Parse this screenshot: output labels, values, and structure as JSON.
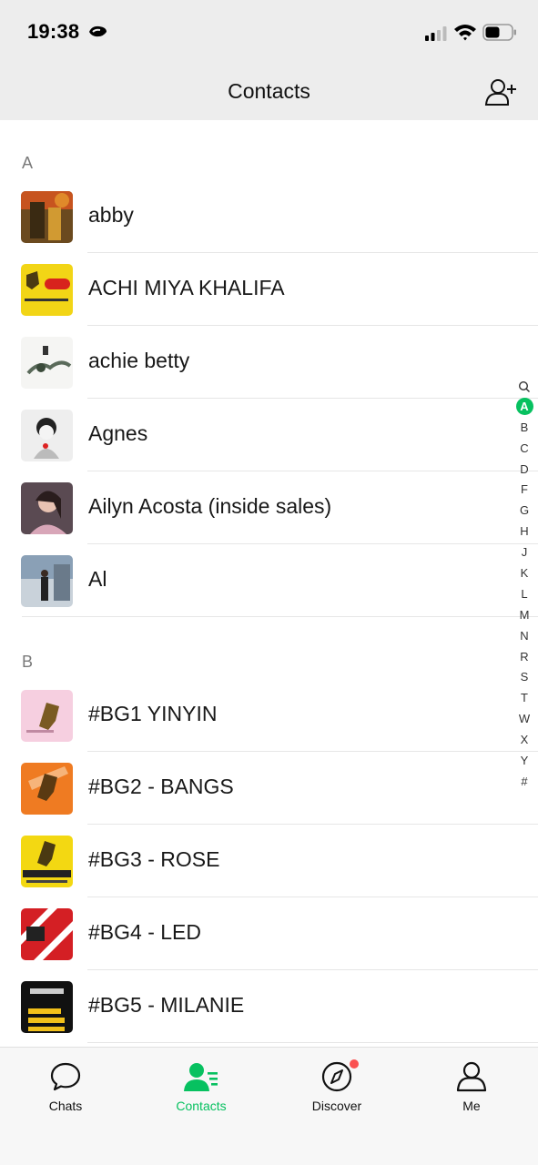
{
  "status_bar": {
    "time": "19:38"
  },
  "header": {
    "title": "Contacts"
  },
  "sections": [
    {
      "letter": "A",
      "contacts": [
        {
          "name": "abby"
        },
        {
          "name": "ACHI MIYA KHALIFA"
        },
        {
          "name": "achie betty"
        },
        {
          "name": "Agnes"
        },
        {
          "name": "Ailyn Acosta (inside sales)"
        },
        {
          "name": "Al"
        }
      ]
    },
    {
      "letter": "B",
      "contacts": [
        {
          "name": "#BG1 YINYIN"
        },
        {
          "name": "#BG2 - BANGS"
        },
        {
          "name": "#BG3 - ROSE"
        },
        {
          "name": "#BG4 - LED"
        },
        {
          "name": "#BG5 - MILANIE"
        }
      ]
    }
  ],
  "index_bar": [
    "A",
    "B",
    "C",
    "D",
    "F",
    "G",
    "H",
    "J",
    "K",
    "L",
    "M",
    "N",
    "R",
    "S",
    "T",
    "W",
    "X",
    "Y",
    "#"
  ],
  "index_active": "A",
  "tabs": [
    {
      "label": "Chats",
      "icon": "chat-bubble-icon"
    },
    {
      "label": "Contacts",
      "icon": "contacts-icon"
    },
    {
      "label": "Discover",
      "icon": "compass-icon"
    },
    {
      "label": "Me",
      "icon": "person-icon"
    }
  ],
  "colors": {
    "accent": "#07c160",
    "badge": "#fa5151",
    "header_bg": "#ededed"
  }
}
